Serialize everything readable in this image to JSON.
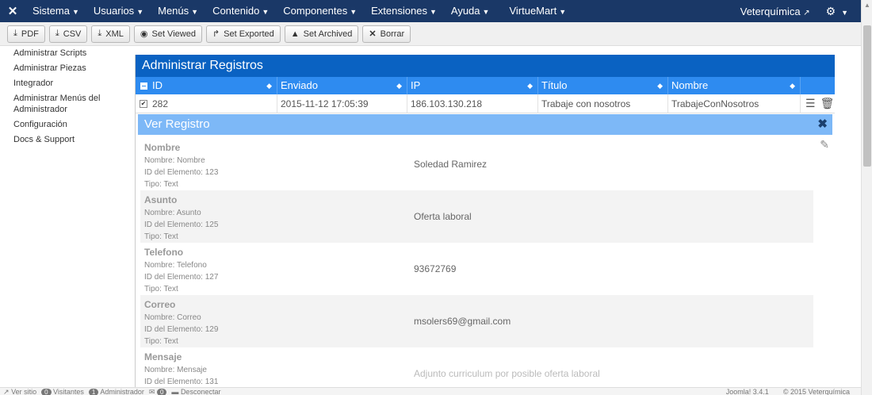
{
  "topnav": {
    "logo_icon": "joomla-logo-icon",
    "menu": [
      {
        "label": "Sistema"
      },
      {
        "label": "Usuarios"
      },
      {
        "label": "Menús"
      },
      {
        "label": "Contenido"
      },
      {
        "label": "Componentes"
      },
      {
        "label": "Extensiones"
      },
      {
        "label": "Ayuda"
      },
      {
        "label": "VirtueMart"
      }
    ],
    "site_name": "Veterquímica",
    "settings_icon": "gear-icon"
  },
  "toolbar": {
    "buttons": [
      {
        "label": "PDF",
        "icon": "download-icon"
      },
      {
        "label": "CSV",
        "icon": "download-icon"
      },
      {
        "label": "XML",
        "icon": "download-icon"
      },
      {
        "label": "Set Viewed",
        "icon": "eye-icon"
      },
      {
        "label": "Set Exported",
        "icon": "share-icon"
      },
      {
        "label": "Set Archived",
        "icon": "archive-icon"
      },
      {
        "label": "Borrar",
        "icon": "close-icon"
      }
    ]
  },
  "sidebar": {
    "items": [
      {
        "label": "Administrar Scripts"
      },
      {
        "label": "Administrar Piezas"
      },
      {
        "label": "Integrador"
      },
      {
        "label": "Administrar Menús del Administrador"
      },
      {
        "label": "Configuración"
      },
      {
        "label": "Docs & Support"
      }
    ]
  },
  "main": {
    "title": "Administrar Registros",
    "columns": [
      "ID",
      "Enviado",
      "IP",
      "Título",
      "Nombre"
    ],
    "row": {
      "id": "282",
      "enviado": "2015-11-12 17:05:39",
      "ip": "186.103.130.218",
      "titulo": "Trabaje con nosotros",
      "nombre": "TrabajeConNosotros"
    },
    "detail": {
      "title": "Ver Registro",
      "fields": [
        {
          "name": "Nombre",
          "sub_name": "Nombre: Nombre",
          "sub_id": "ID del Elemento: 123",
          "sub_type": "Tipo: Text",
          "value": "Soledad Ramirez"
        },
        {
          "name": "Asunto",
          "sub_name": "Nombre: Asunto",
          "sub_id": "ID del Elemento: 125",
          "sub_type": "Tipo: Text",
          "value": "Oferta laboral"
        },
        {
          "name": "Telefono",
          "sub_name": "Nombre: Telefono",
          "sub_id": "ID del Elemento: 127",
          "sub_type": "Tipo: Text",
          "value": "93672769"
        },
        {
          "name": "Correo",
          "sub_name": "Nombre: Correo",
          "sub_id": "ID del Elemento: 129",
          "sub_type": "Tipo: Text",
          "value": "msolers69@gmail.com"
        },
        {
          "name": "Mensaje",
          "sub_name": "Nombre: Mensaje",
          "sub_id": "ID del Elemento: 131",
          "sub_type": "",
          "value": "Adjunto curriculum por posible oferta laboral"
        }
      ]
    }
  },
  "footer": {
    "view_site": "Ver sitio",
    "visitors_count": "0",
    "visitors_label": "Visitantes",
    "admins_count": "1",
    "admins_label": "Administrador",
    "messages_count": "0",
    "logout_label": "Desconectar",
    "version": "Joomla! 3.4.1",
    "copyright": "© 2015 Veterquímica"
  }
}
